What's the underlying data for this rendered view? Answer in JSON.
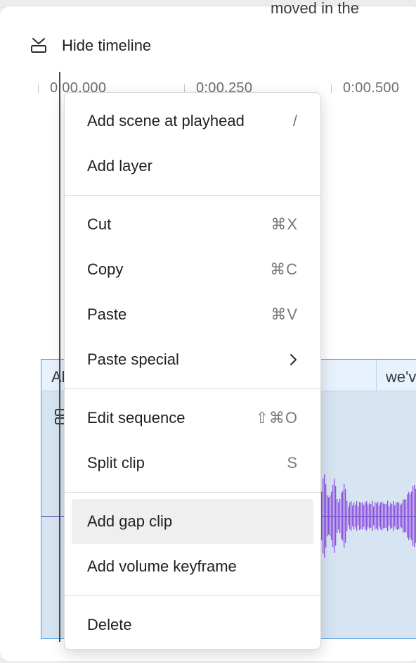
{
  "background_text": "moved in the",
  "toolbar": {
    "hide_timeline_label": "Hide timeline",
    "hide_timeline_icon": "hide-timeline-icon"
  },
  "ruler": {
    "labels": [
      "0:00.000",
      "0:00.250",
      "0:00.500"
    ]
  },
  "track": {
    "clip_text_left": "Al",
    "clip_text_right": "we'v",
    "waveform_color": "#8c4fe0"
  },
  "context_menu": {
    "items": [
      {
        "label": "Add scene at playhead",
        "shortcut": "/"
      },
      {
        "label": "Add layer",
        "shortcut": ""
      },
      {
        "label": "Cut",
        "shortcut": "⌘X"
      },
      {
        "label": "Copy",
        "shortcut": "⌘C"
      },
      {
        "label": "Paste",
        "shortcut": "⌘V"
      },
      {
        "label": "Paste special",
        "shortcut": "",
        "submenu_icon": "chevron-right-icon"
      },
      {
        "label": "Edit sequence",
        "shortcut": "⇧⌘O"
      },
      {
        "label": "Split clip",
        "shortcut": "S"
      },
      {
        "label": "Add gap clip",
        "shortcut": "",
        "highlighted": true
      },
      {
        "label": "Add volume keyframe",
        "shortcut": ""
      },
      {
        "label": "Delete",
        "shortcut": ""
      }
    ]
  },
  "colors": {
    "selection_border": "#4a9fe6",
    "track_fill": "#d7e4f1",
    "menu_highlight": "#efefef"
  }
}
